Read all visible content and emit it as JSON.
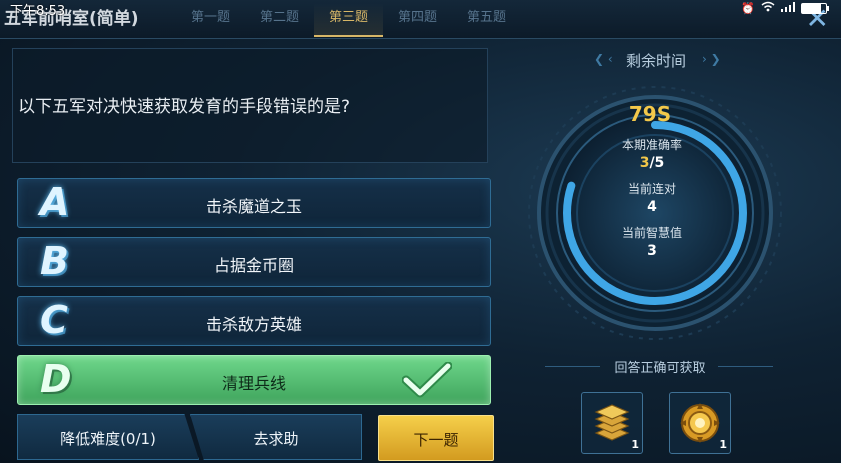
{
  "status_bar": {
    "time": "下午8:53",
    "icons": [
      "alarm-icon",
      "wifi-icon",
      "signal-icon",
      "battery-icon"
    ]
  },
  "header": {
    "title": "五军前哨室(简单)",
    "tabs": [
      {
        "label": "第一题",
        "active": false
      },
      {
        "label": "第二题",
        "active": false
      },
      {
        "label": "第三题",
        "active": true
      },
      {
        "label": "第四题",
        "active": false
      },
      {
        "label": "第五题",
        "active": false
      }
    ],
    "close_icon": "close-icon"
  },
  "question": {
    "text": "以下五军对决快速获取发育的手段错误的是?"
  },
  "options": [
    {
      "letter": "A",
      "text": "击杀魔道之玉",
      "correct": false
    },
    {
      "letter": "B",
      "text": "占据金币圈",
      "correct": false
    },
    {
      "letter": "C",
      "text": "击杀敌方英雄",
      "correct": false
    },
    {
      "letter": "D",
      "text": "清理兵线",
      "correct": true
    }
  ],
  "buttons": {
    "reduce_difficulty": "降低难度(0/1)",
    "ask_help": "去求助",
    "next": "下一题"
  },
  "timer": {
    "title": "剩余时间",
    "time_left": "79S",
    "accuracy_label": "本期准确率",
    "accuracy_correct": "3",
    "accuracy_total": "/5",
    "streak_label": "当前连对",
    "streak_value": "4",
    "wisdom_label": "当前智慧值",
    "wisdom_value": "3"
  },
  "reward": {
    "title": "回答正确可获取",
    "items": [
      {
        "icon": "stacked-coins-icon",
        "count": "1"
      },
      {
        "icon": "gold-badge-icon",
        "count": "1"
      }
    ]
  },
  "colors": {
    "accent_gold": "#f3c84a",
    "correct_green": "#4fc06c",
    "panel_border": "#2f6c94"
  }
}
